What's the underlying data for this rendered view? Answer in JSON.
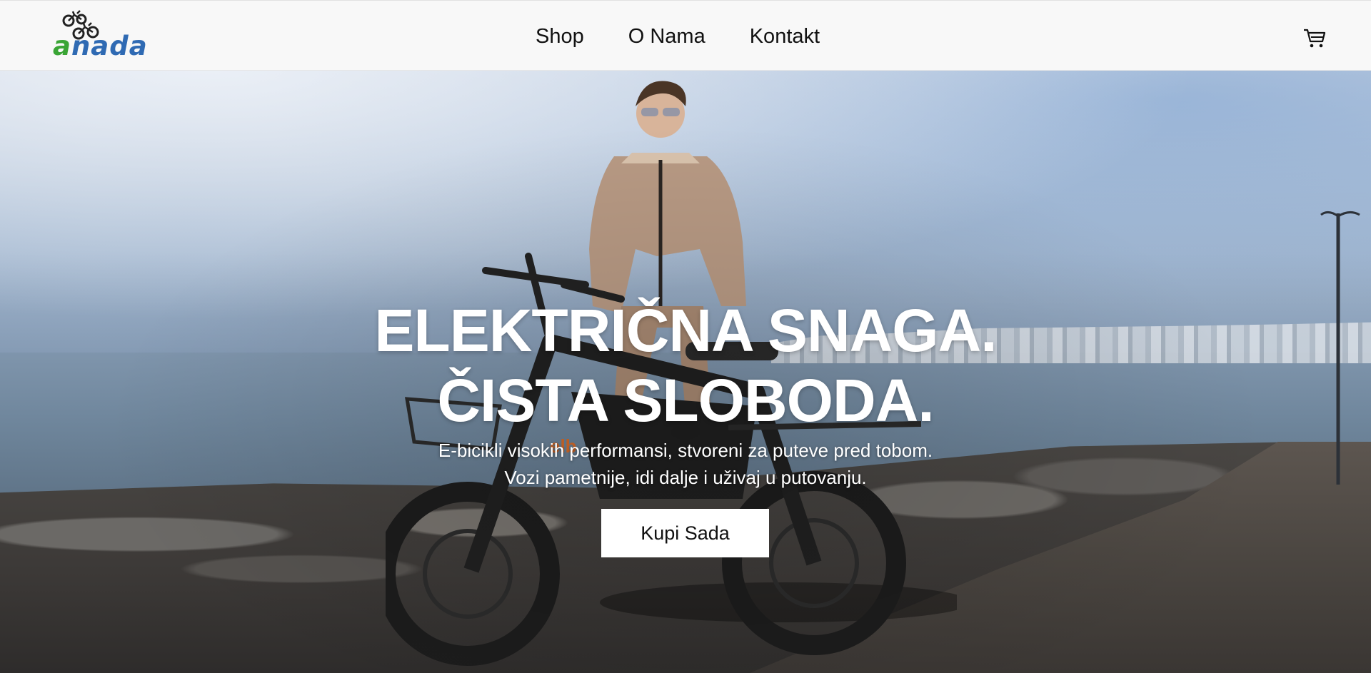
{
  "header": {
    "logo_text": "nada",
    "logo_letter": "a",
    "nav": [
      {
        "label": "Shop"
      },
      {
        "label": "O Nama"
      },
      {
        "label": "Kontakt"
      }
    ],
    "cart_icon": "cart-icon"
  },
  "hero": {
    "headline_line1": "ELEKTRIČNA SNAGA.",
    "headline_line2": "ČISTA SLOBODA.",
    "subtitle_line1": "E-bicikli visokih performansi, stvoreni za puteve pred tobom.",
    "subtitle_line2": "Vozi pametnije, idi dalje i uživaj u putovanju.",
    "cta_label": "Kupi Sada"
  },
  "colors": {
    "brand_blue": "#2f6ab3",
    "brand_green": "#3aa535",
    "header_bg": "#f8f8f8"
  }
}
